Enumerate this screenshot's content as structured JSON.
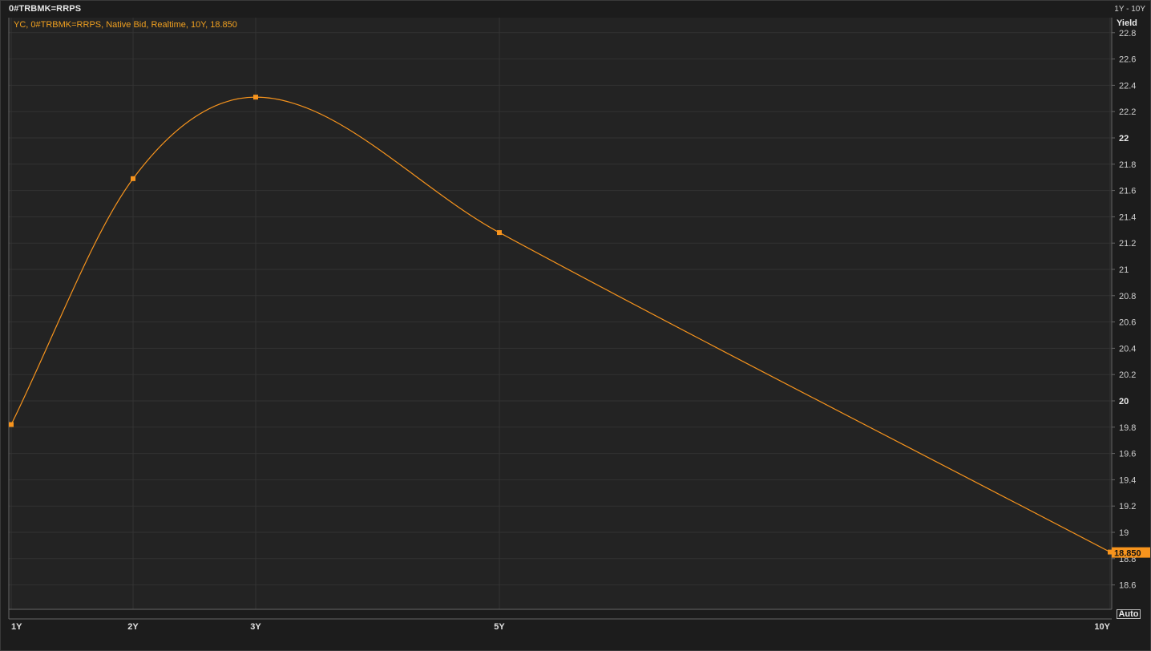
{
  "window": {
    "title": "0#TRBMK=RRPS",
    "range_label": "1Y - 10Y",
    "auto_label": "Auto"
  },
  "colors": {
    "series": "#f7941d",
    "plot_bg": "#232323",
    "grid": "#333333",
    "axis": "#666666"
  },
  "chart_data": {
    "type": "line",
    "legend": "YC, 0#TRBMK=RRPS, Native Bid, Realtime, 10Y, 18.850",
    "ylabel": "Yield",
    "x_categories": [
      "1Y",
      "2Y",
      "3Y",
      "5Y",
      "10Y"
    ],
    "x_years": [
      1,
      2,
      3,
      5,
      10
    ],
    "values": [
      19.82,
      21.69,
      22.31,
      21.28,
      18.85
    ],
    "last_value_label": "18.850",
    "ylim": [
      18.45,
      22.9
    ],
    "yticks": [
      18.6,
      18.8,
      19,
      19.2,
      19.4,
      19.6,
      19.8,
      20,
      20.2,
      20.4,
      20.6,
      20.8,
      21,
      21.2,
      21.4,
      21.6,
      21.8,
      22,
      22.2,
      22.4,
      22.6,
      22.8
    ],
    "ytick_labels": [
      "18.6",
      "18.8",
      "19",
      "19.2",
      "19.4",
      "19.6",
      "19.8",
      "20",
      "20.2",
      "20.4",
      "20.6",
      "20.8",
      "21",
      "21.2",
      "21.4",
      "21.6",
      "21.8",
      "22",
      "22.2",
      "22.4",
      "22.6",
      "22.8"
    ],
    "major_ticks": [
      "20",
      "22"
    ],
    "grid": true
  }
}
